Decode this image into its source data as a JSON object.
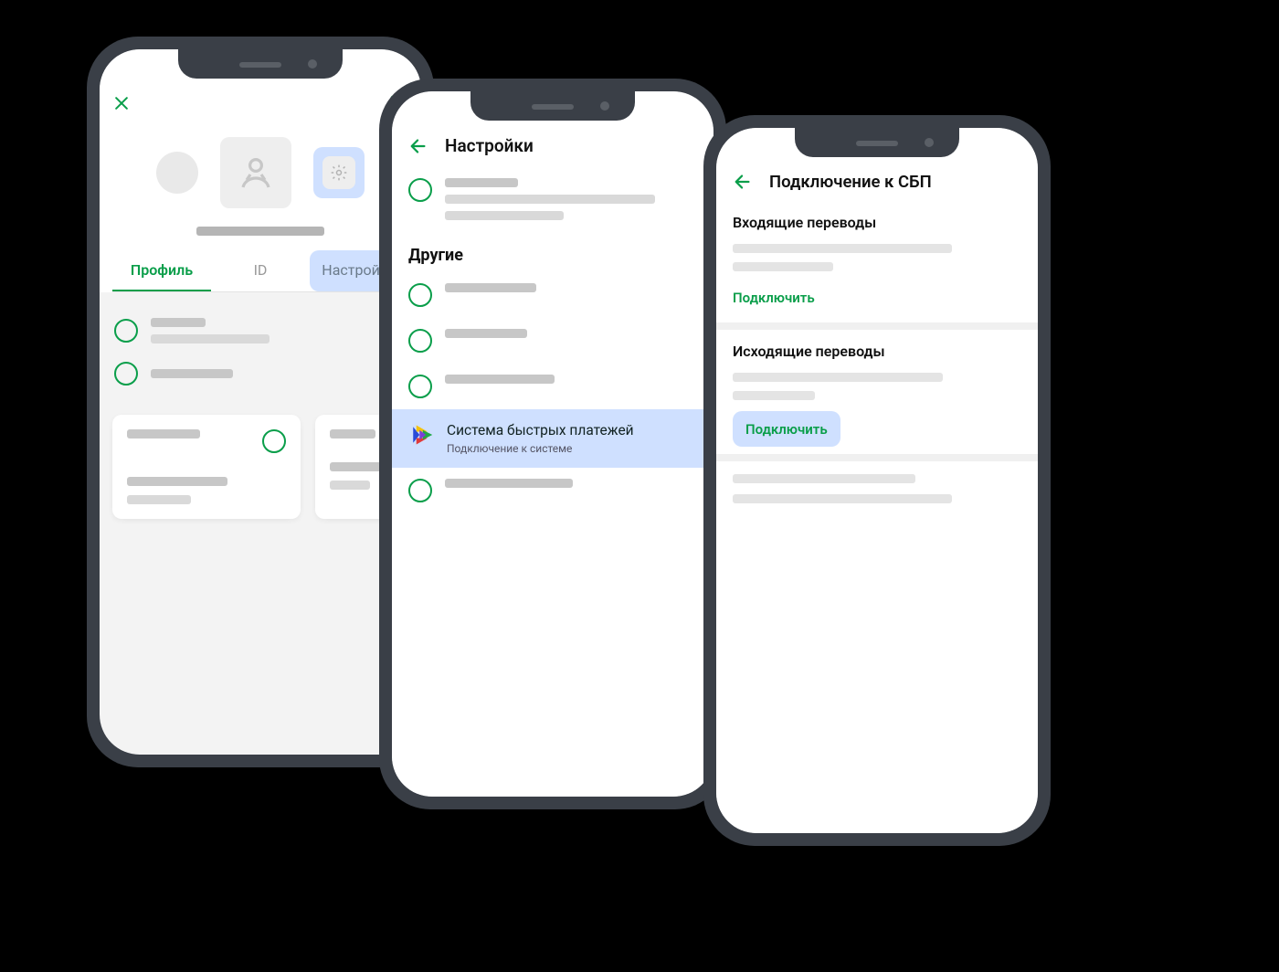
{
  "colors": {
    "accent": "#0a9e4a",
    "highlight": "#cfe0ff"
  },
  "phone1": {
    "tabs": {
      "profile": "Профиль",
      "id": "ID",
      "settings": "Настройки"
    }
  },
  "phone2": {
    "title": "Настройки",
    "section_other": "Другие",
    "sbp": {
      "title": "Система быстрых платежей",
      "subtitle": "Подключение к системе"
    }
  },
  "phone3": {
    "title": "Подключение к СБП",
    "incoming": {
      "title": "Входящие переводы",
      "action": "Подключить"
    },
    "outgoing": {
      "title": "Исходящие переводы",
      "action": "Подключить"
    }
  }
}
